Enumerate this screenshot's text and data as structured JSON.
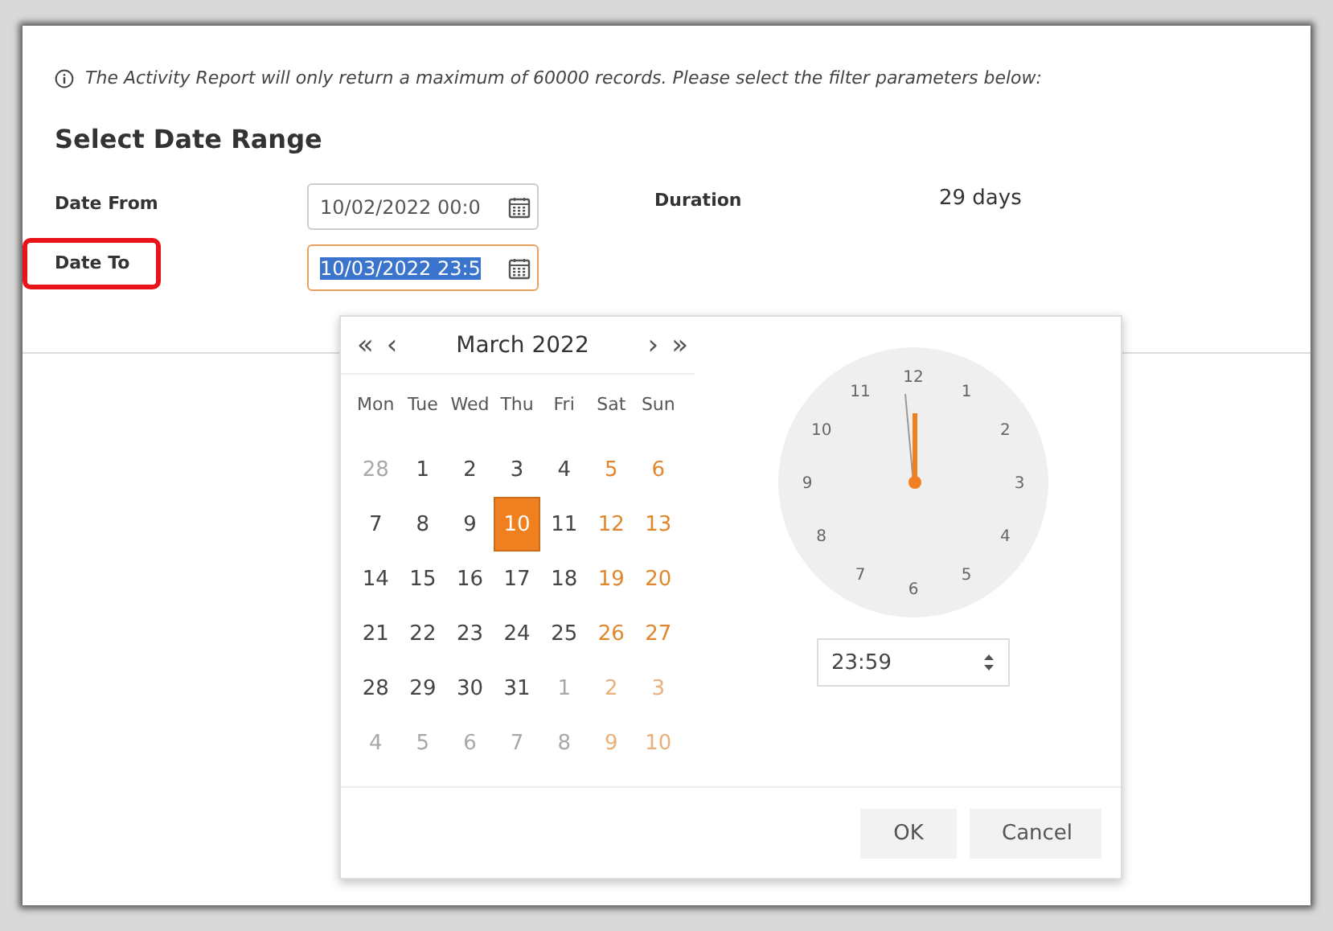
{
  "notice": "The Activity Report will only return a maximum of 60000 records. Please select the filter parameters below:",
  "heading": "Select Date Range",
  "fields": [
    {
      "label": "Date From",
      "value": "10/02/2022 00:0",
      "focused": false,
      "highlighted": false
    },
    {
      "label": "Date To",
      "value": "10/03/2022 23:5",
      "focused": true,
      "highlighted": true
    }
  ],
  "duration": {
    "label": "Duration",
    "value": "29 days"
  },
  "picker": {
    "nav": {
      "first": "«",
      "prev": "‹",
      "title": "March 2022",
      "next": "›",
      "last": "»"
    },
    "weekdays": [
      "Mon",
      "Tue",
      "Wed",
      "Thu",
      "Fri",
      "Sat",
      "Sun"
    ],
    "weeks": [
      [
        {
          "day": "28",
          "other_month": true,
          "weekend": false,
          "selected": false
        },
        {
          "day": "1",
          "other_month": false,
          "weekend": false,
          "selected": false
        },
        {
          "day": "2",
          "other_month": false,
          "weekend": false,
          "selected": false
        },
        {
          "day": "3",
          "other_month": false,
          "weekend": false,
          "selected": false
        },
        {
          "day": "4",
          "other_month": false,
          "weekend": false,
          "selected": false
        },
        {
          "day": "5",
          "other_month": false,
          "weekend": true,
          "selected": false
        },
        {
          "day": "6",
          "other_month": false,
          "weekend": true,
          "selected": false
        }
      ],
      [
        {
          "day": "7",
          "other_month": false,
          "weekend": false,
          "selected": false
        },
        {
          "day": "8",
          "other_month": false,
          "weekend": false,
          "selected": false
        },
        {
          "day": "9",
          "other_month": false,
          "weekend": false,
          "selected": false
        },
        {
          "day": "10",
          "other_month": false,
          "weekend": false,
          "selected": true
        },
        {
          "day": "11",
          "other_month": false,
          "weekend": false,
          "selected": false
        },
        {
          "day": "12",
          "other_month": false,
          "weekend": true,
          "selected": false
        },
        {
          "day": "13",
          "other_month": false,
          "weekend": true,
          "selected": false
        }
      ],
      [
        {
          "day": "14",
          "other_month": false,
          "weekend": false,
          "selected": false
        },
        {
          "day": "15",
          "other_month": false,
          "weekend": false,
          "selected": false
        },
        {
          "day": "16",
          "other_month": false,
          "weekend": false,
          "selected": false
        },
        {
          "day": "17",
          "other_month": false,
          "weekend": false,
          "selected": false
        },
        {
          "day": "18",
          "other_month": false,
          "weekend": false,
          "selected": false
        },
        {
          "day": "19",
          "other_month": false,
          "weekend": true,
          "selected": false
        },
        {
          "day": "20",
          "other_month": false,
          "weekend": true,
          "selected": false
        }
      ],
      [
        {
          "day": "21",
          "other_month": false,
          "weekend": false,
          "selected": false
        },
        {
          "day": "22",
          "other_month": false,
          "weekend": false,
          "selected": false
        },
        {
          "day": "23",
          "other_month": false,
          "weekend": false,
          "selected": false
        },
        {
          "day": "24",
          "other_month": false,
          "weekend": false,
          "selected": false
        },
        {
          "day": "25",
          "other_month": false,
          "weekend": false,
          "selected": false
        },
        {
          "day": "26",
          "other_month": false,
          "weekend": true,
          "selected": false
        },
        {
          "day": "27",
          "other_month": false,
          "weekend": true,
          "selected": false
        }
      ],
      [
        {
          "day": "28",
          "other_month": false,
          "weekend": false,
          "selected": false
        },
        {
          "day": "29",
          "other_month": false,
          "weekend": false,
          "selected": false
        },
        {
          "day": "30",
          "other_month": false,
          "weekend": false,
          "selected": false
        },
        {
          "day": "31",
          "other_month": false,
          "weekend": false,
          "selected": false
        },
        {
          "day": "1",
          "other_month": true,
          "weekend": false,
          "selected": false
        },
        {
          "day": "2",
          "other_month": true,
          "weekend": true,
          "selected": false
        },
        {
          "day": "3",
          "other_month": true,
          "weekend": true,
          "selected": false
        }
      ],
      [
        {
          "day": "4",
          "other_month": true,
          "weekend": false,
          "selected": false
        },
        {
          "day": "5",
          "other_month": true,
          "weekend": false,
          "selected": false
        },
        {
          "day": "6",
          "other_month": true,
          "weekend": false,
          "selected": false
        },
        {
          "day": "7",
          "other_month": true,
          "weekend": false,
          "selected": false
        },
        {
          "day": "8",
          "other_month": true,
          "weekend": false,
          "selected": false
        },
        {
          "day": "9",
          "other_month": true,
          "weekend": true,
          "selected": false
        },
        {
          "day": "10",
          "other_month": true,
          "weekend": true,
          "selected": false
        }
      ]
    ],
    "clock_numbers": [
      "12",
      "1",
      "2",
      "3",
      "4",
      "5",
      "6",
      "7",
      "8",
      "9",
      "10",
      "11"
    ],
    "time": "23:59",
    "buttons": [
      "OK",
      "Cancel"
    ]
  }
}
